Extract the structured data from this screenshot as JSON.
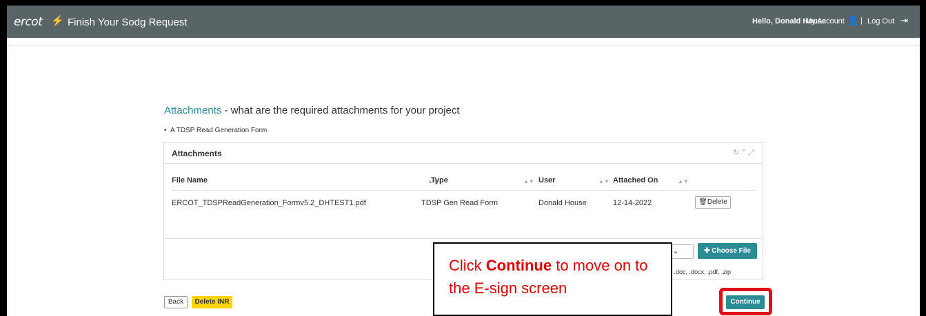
{
  "header": {
    "logo_text": "ercot",
    "title": "Finish Your Sodg Request",
    "greeting": "Hello, Donald House",
    "my_account": "My Account",
    "separator": "|",
    "logout": "Log Out",
    "icons": [
      "bolt-logo-icon",
      "user-icon",
      "logout-icon"
    ]
  },
  "section": {
    "heading_accent": "Attachments",
    "heading_rest": " - what are the required attachments for your project",
    "requirements": [
      "A TDSP Read Generation Form"
    ]
  },
  "attachments_panel": {
    "title": "Attachments",
    "columns": [
      "File Name",
      "Type",
      "User",
      "Attached On"
    ],
    "rows": [
      {
        "file_name": "ERCOT_TDSPReadGeneration_Formv5.2_DHTEST1.pdf",
        "type": "TDSP Gen Read Form",
        "user": "Donald House",
        "attached_on": "12-14-2022",
        "action": "Delete"
      }
    ],
    "type_select_visible": "m",
    "choose_file": "Choose File",
    "allowed_types_visible": "z, .doc, .docx, .pdf, .zip"
  },
  "footer": {
    "back": "Back",
    "delete_inr": "Delete INR",
    "continue": "Continue"
  },
  "callout": {
    "pre": "Click ",
    "bold": "Continue",
    "post": " to move on to the E-sign screen"
  },
  "colors": {
    "topbar": "#596466",
    "accent": "#2e8b99",
    "primary_button": "#2b8c96",
    "warning_button": "#ffd400",
    "highlight": "#e0101a"
  }
}
